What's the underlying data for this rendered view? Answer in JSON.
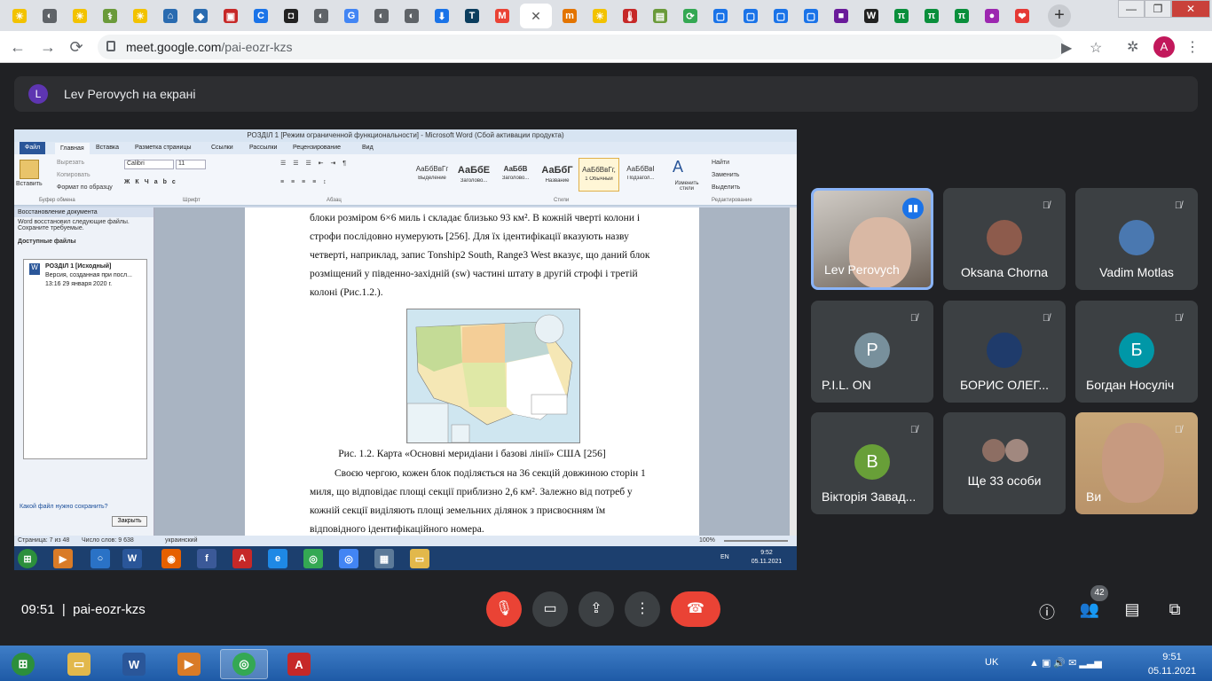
{
  "browser": {
    "url_host": "meet.google.com",
    "url_path": "/pai-eozr-kzs",
    "profile_initial": "A",
    "active_tab_close": "✕",
    "new_tab": "+",
    "tabs": [
      {
        "glyph": "☀",
        "color": "#f2c200"
      },
      {
        "glyph": "◐",
        "color": "#5f6368"
      },
      {
        "glyph": "☀",
        "color": "#f2c200"
      },
      {
        "glyph": "⚕",
        "color": "#6a9a3a"
      },
      {
        "glyph": "☀",
        "color": "#f2c200"
      },
      {
        "glyph": "⌂",
        "color": "#2a6bb0"
      },
      {
        "glyph": "◆",
        "color": "#2a6bb0"
      },
      {
        "glyph": "▣",
        "color": "#c62828"
      },
      {
        "glyph": "C",
        "color": "#1a73e8"
      },
      {
        "glyph": "◘",
        "color": "#222222"
      },
      {
        "glyph": "◐",
        "color": "#5f6368"
      },
      {
        "glyph": "G",
        "color": "#4285f4"
      },
      {
        "glyph": "◐",
        "color": "#5f6368"
      },
      {
        "glyph": "◐",
        "color": "#5f6368"
      },
      {
        "glyph": "⬇",
        "color": "#1a73e8"
      },
      {
        "glyph": "T",
        "color": "#0b3d5e"
      },
      {
        "glyph": "M",
        "color": "#ea4335"
      }
    ],
    "tabs_right": [
      {
        "glyph": "m",
        "color": "#e37400"
      },
      {
        "glyph": "☀",
        "color": "#f2c200"
      },
      {
        "glyph": "🌡",
        "color": "#c62828"
      },
      {
        "glyph": "▤",
        "color": "#6a9a3a"
      },
      {
        "glyph": "⟳",
        "color": "#34a853"
      },
      {
        "glyph": "▢",
        "color": "#1a73e8"
      },
      {
        "glyph": "▢",
        "color": "#1a73e8"
      },
      {
        "glyph": "▢",
        "color": "#1a73e8"
      },
      {
        "glyph": "▢",
        "color": "#1a73e8"
      },
      {
        "glyph": "■",
        "color": "#6a1b9a"
      },
      {
        "glyph": "W",
        "color": "#222222"
      },
      {
        "glyph": "π",
        "color": "#0a8f3c"
      },
      {
        "glyph": "π",
        "color": "#0a8f3c"
      },
      {
        "glyph": "π",
        "color": "#0a8f3c"
      },
      {
        "glyph": "●",
        "color": "#9c27b0"
      },
      {
        "glyph": "❤",
        "color": "#e53935"
      }
    ]
  },
  "banner": {
    "initial": "L",
    "text": "Lev Perovych на екрані"
  },
  "word": {
    "title": "РОЗДІЛ 1 [Режим ограниченной функциональности] - Microsoft Word (Сбой активации продукта)",
    "tabs": [
      "Файл",
      "Главная",
      "Вставка",
      "Разметка страницы",
      "Ссылки",
      "Рассылки",
      "Рецензирование",
      "Вид"
    ],
    "clipboard": {
      "paste": "Вставить",
      "cut": "Вырезать",
      "copy": "Копировать",
      "format": "Формат по образцу",
      "group": "Буфер обмена"
    },
    "font": {
      "name": "Calibri",
      "size": "11",
      "group": "Шрифт"
    },
    "paragraph_group": "Абзац",
    "styles": [
      {
        "preview": "АаБбВвГг",
        "name": "Выделение"
      },
      {
        "preview": "АаБбЕ",
        "name": "Заголово..."
      },
      {
        "preview": "АаБбВ",
        "name": "Заголово..."
      },
      {
        "preview": "АаБбГ",
        "name": "Название"
      },
      {
        "preview": "АаБбВвГг,",
        "name": "1 Обычный"
      },
      {
        "preview": "АаБбВвІ",
        "name": "Подзагол..."
      }
    ],
    "styles_group": "Стили",
    "change_styles": "Изменить стили",
    "edit": {
      "find": "Найти",
      "replace": "Заменить",
      "select": "Выделить",
      "group": "Редактирование"
    },
    "recovery": {
      "header": "Восстановление документа",
      "msg": "Word восстановил следующие файлы. Сохраните требуемые.",
      "available": "Доступные файлы",
      "file_name": "РОЗДІЛ 1 [Исходный]",
      "file_desc": "Версия, созданная при посл...",
      "file_time": "13:16 29 января 2020 г.",
      "help": "Какой файл нужно сохранить?",
      "close": "Закрыть"
    },
    "doc": {
      "lines": [
        "блоки розміром 6×6 миль і складає близько 93 км². В кожній чверті колони і",
        "строфи послідовно нумерують [256]. Для їх ідентифікації вказують назву",
        "четверті, наприклад, запис Tonship2 South, Range3 West вказує, що даний блок",
        "розміщений у південно-західній (sw) частині штату в другій строфі і третій",
        "колоні (Рис.1.2.)."
      ],
      "caption": "Рис. 1.2. Карта «Основні меридіани і базові лінії» США [256]",
      "lines2": [
        "Своєю чергою, кожен блок поділяється на 36 секцій довжиною сторін 1",
        "миля, що відповідає площі секції приблизно 2,6 км². Залежно від потреб у",
        "кожній секції виділяють площі земельних ділянок з присвоєнням їм",
        "відповідного ідентифікаційного номера."
      ]
    },
    "status": {
      "page": "Страница: 7 из 48",
      "words": "Число слов: 9 638",
      "lang": "украинский",
      "zoom": "100%"
    },
    "taskbar": {
      "lang": "EN",
      "time": "9:52",
      "date": "05.11.2021"
    }
  },
  "participants": [
    {
      "name": "Lev Perovych",
      "type": "video",
      "active": true
    },
    {
      "name": "Oksana Chorna",
      "type": "photo",
      "photo_color": "#8d5b4c"
    },
    {
      "name": "Vadim Motlas",
      "type": "photo",
      "photo_color": "#4a78b0"
    },
    {
      "name": "P.I.L. ON",
      "type": "letter",
      "initial": "P",
      "color": "#78909c"
    },
    {
      "name": "БОРИС ОЛЕГ...",
      "type": "photo",
      "photo_color": "#1f3b6b"
    },
    {
      "name": "Богдан Носуліч",
      "type": "letter",
      "initial": "Б",
      "color": "#0097a7"
    },
    {
      "name": "Вікторія Завад...",
      "type": "letter",
      "initial": "В",
      "color": "#689f38"
    },
    {
      "name": "Ще 33 особи",
      "type": "group"
    },
    {
      "name": "Ви",
      "type": "video_self"
    }
  ],
  "meeting": {
    "time": "09:51",
    "code": "pai-eozr-kzs",
    "people_count": "42"
  },
  "os": {
    "lang": "UK",
    "time": "9:51",
    "date": "05.11.2021"
  }
}
